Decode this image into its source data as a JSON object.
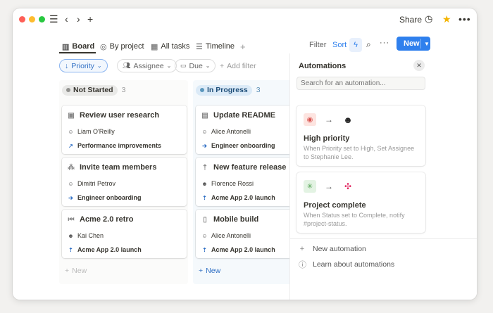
{
  "titlebar": {
    "share_label": "Share",
    "menu_icon": "menu-icon",
    "back_icon": "chevron-left-icon",
    "forward_icon": "chevron-right-icon",
    "add_icon": "plus-icon",
    "clock_icon": "clock-icon",
    "star_icon": "star-icon",
    "more_icon": "more-icon"
  },
  "colors": {
    "accent": "#2f80ed",
    "star": "#f4b400",
    "traffic_red": "#fe5f57",
    "traffic_yellow": "#febc2e",
    "traffic_green": "#28c840"
  },
  "views": [
    {
      "label": "Board",
      "icon": "board-icon"
    },
    {
      "label": "By project",
      "icon": "target-icon"
    },
    {
      "label": "All tasks",
      "icon": "table-icon"
    },
    {
      "label": "Timeline",
      "icon": "timeline-icon"
    }
  ],
  "toolbar": {
    "filter_label": "Filter",
    "sort_label": "Sort",
    "new_label": "New"
  },
  "filters": {
    "priority": "Priority",
    "assignee": "Assignee",
    "due": "Due",
    "add_filter": "Add filter"
  },
  "columns": [
    {
      "status": "Not Started",
      "count": "3",
      "cards": [
        {
          "title": "Review user research",
          "assignee": "Liam O'Reilly",
          "relation": "Performance improvements"
        },
        {
          "title": "Invite team members",
          "assignee": "Dimitri Petrov",
          "relation": "Engineer onboarding"
        },
        {
          "title": "Acme 2.0 retro",
          "assignee": "Kai Chen",
          "relation": "Acme App 2.0 launch"
        }
      ],
      "new_label": "New"
    },
    {
      "status": "In Progress",
      "count": "3",
      "cards": [
        {
          "title": "Update README",
          "assignee": "Alice Antonelli",
          "relation": "Engineer onboarding"
        },
        {
          "title": "New feature release",
          "assignee": "Florence Rossi",
          "relation": "Acme App 2.0 launch"
        },
        {
          "title": "Mobile build",
          "assignee": "Alice Antonelli",
          "relation": "Acme App 2.0 launch"
        }
      ],
      "new_label": "New"
    }
  ],
  "automations": {
    "title": "Automations",
    "search_placeholder": "Search for an automation...",
    "items": [
      {
        "name": "High priority",
        "description": "When Priority set to High, Set Assignee to Stephanie Lee."
      },
      {
        "name": "Project complete",
        "description": "When Status set to Complete, notify #project-status."
      }
    ],
    "new_automation": "New automation",
    "learn_link": "Learn about automations"
  }
}
